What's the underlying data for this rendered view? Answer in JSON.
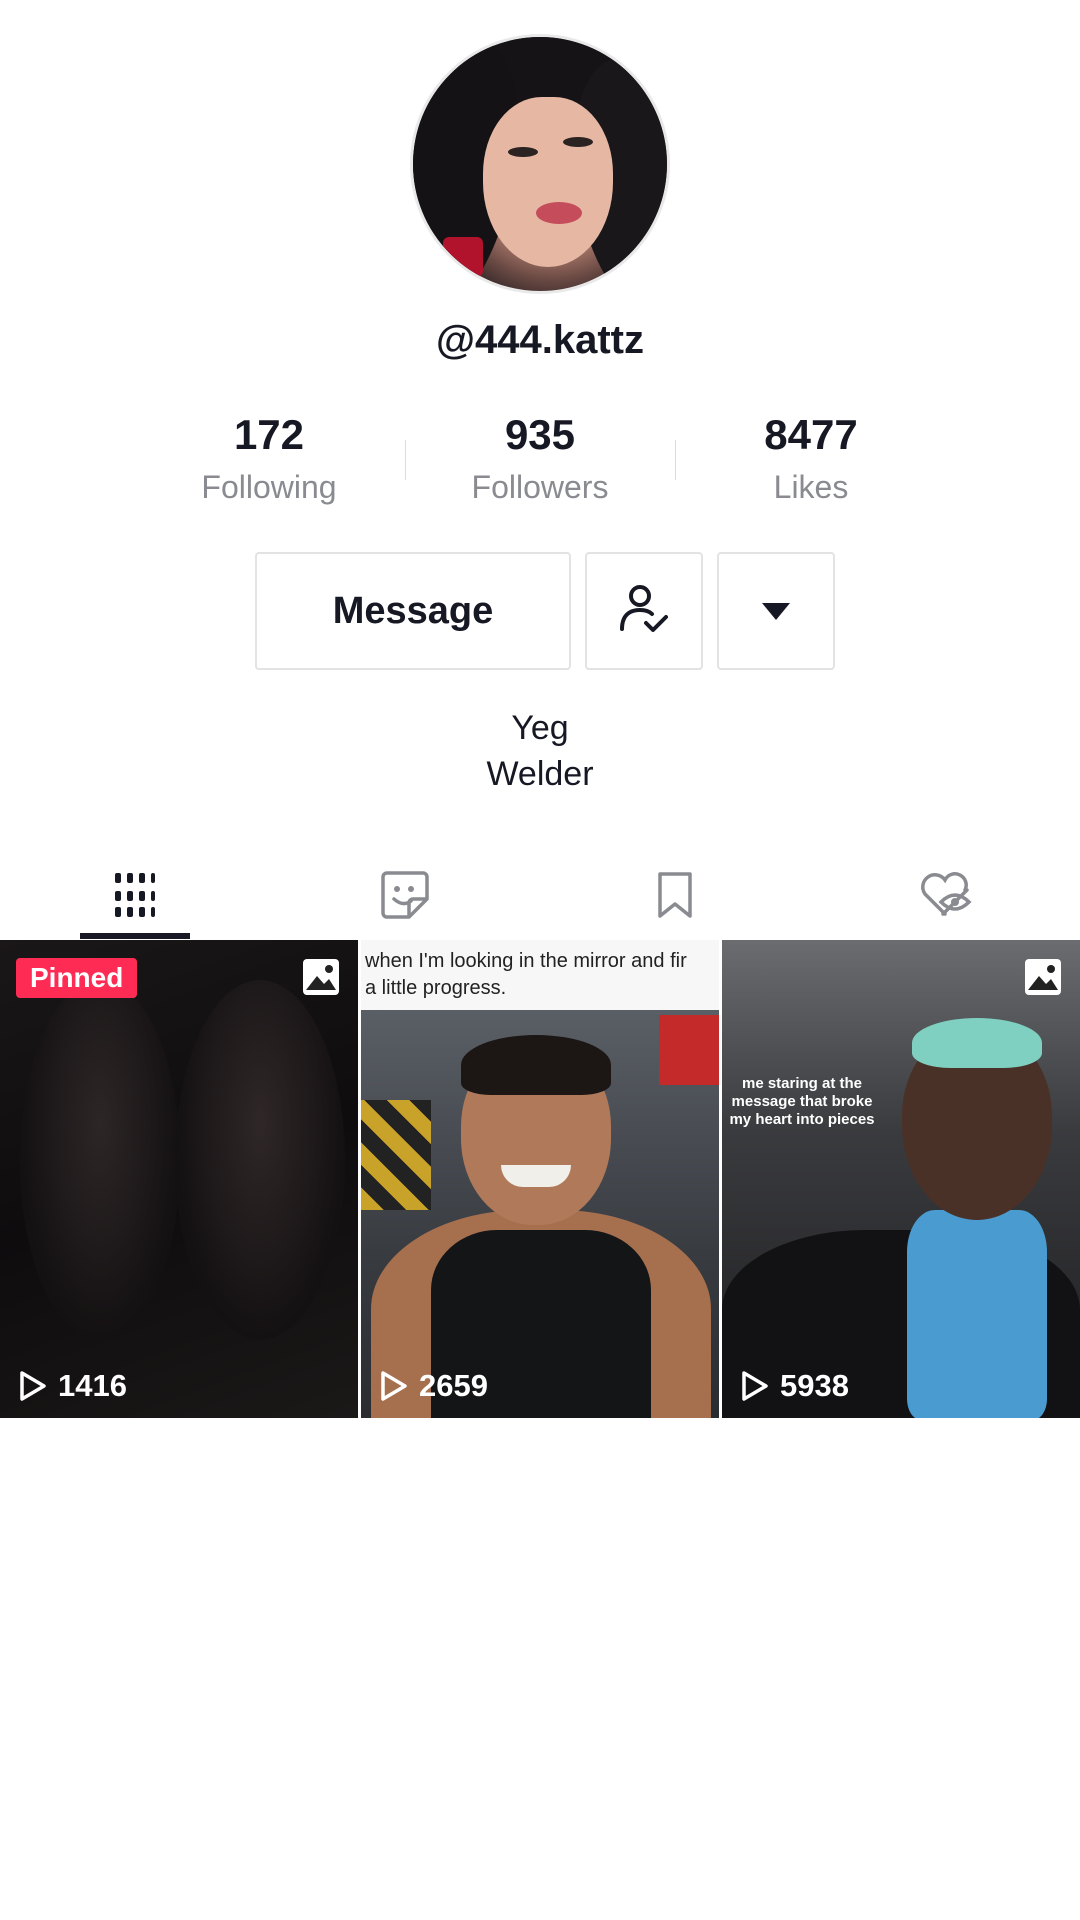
{
  "profile": {
    "username": "@444.kattz",
    "bio_line1": "Yeg",
    "bio_line2": "Welder"
  },
  "stats": [
    {
      "value": "172",
      "label": "Following"
    },
    {
      "value": "935",
      "label": "Followers"
    },
    {
      "value": "8477",
      "label": "Likes"
    }
  ],
  "actions": {
    "message_label": "Message"
  },
  "tabs": [
    {
      "icon": "grid-icon",
      "selected": true
    },
    {
      "icon": "sticker-icon",
      "selected": false
    },
    {
      "icon": "bookmark-icon",
      "selected": false
    },
    {
      "icon": "liked-hidden-icon",
      "selected": false
    }
  ],
  "videos": [
    {
      "views": "1416",
      "badge": "Pinned",
      "photo_icon": true
    },
    {
      "views": "2659",
      "caption": "when I'm looking in the mirror and fir\na little progress."
    },
    {
      "views": "5938",
      "caption": "me staring at the message that broke my heart into pieces",
      "photo_icon": true
    }
  ],
  "colors": {
    "accent": "#fe2c55",
    "text": "#161823",
    "muted": "#8a8b91"
  }
}
